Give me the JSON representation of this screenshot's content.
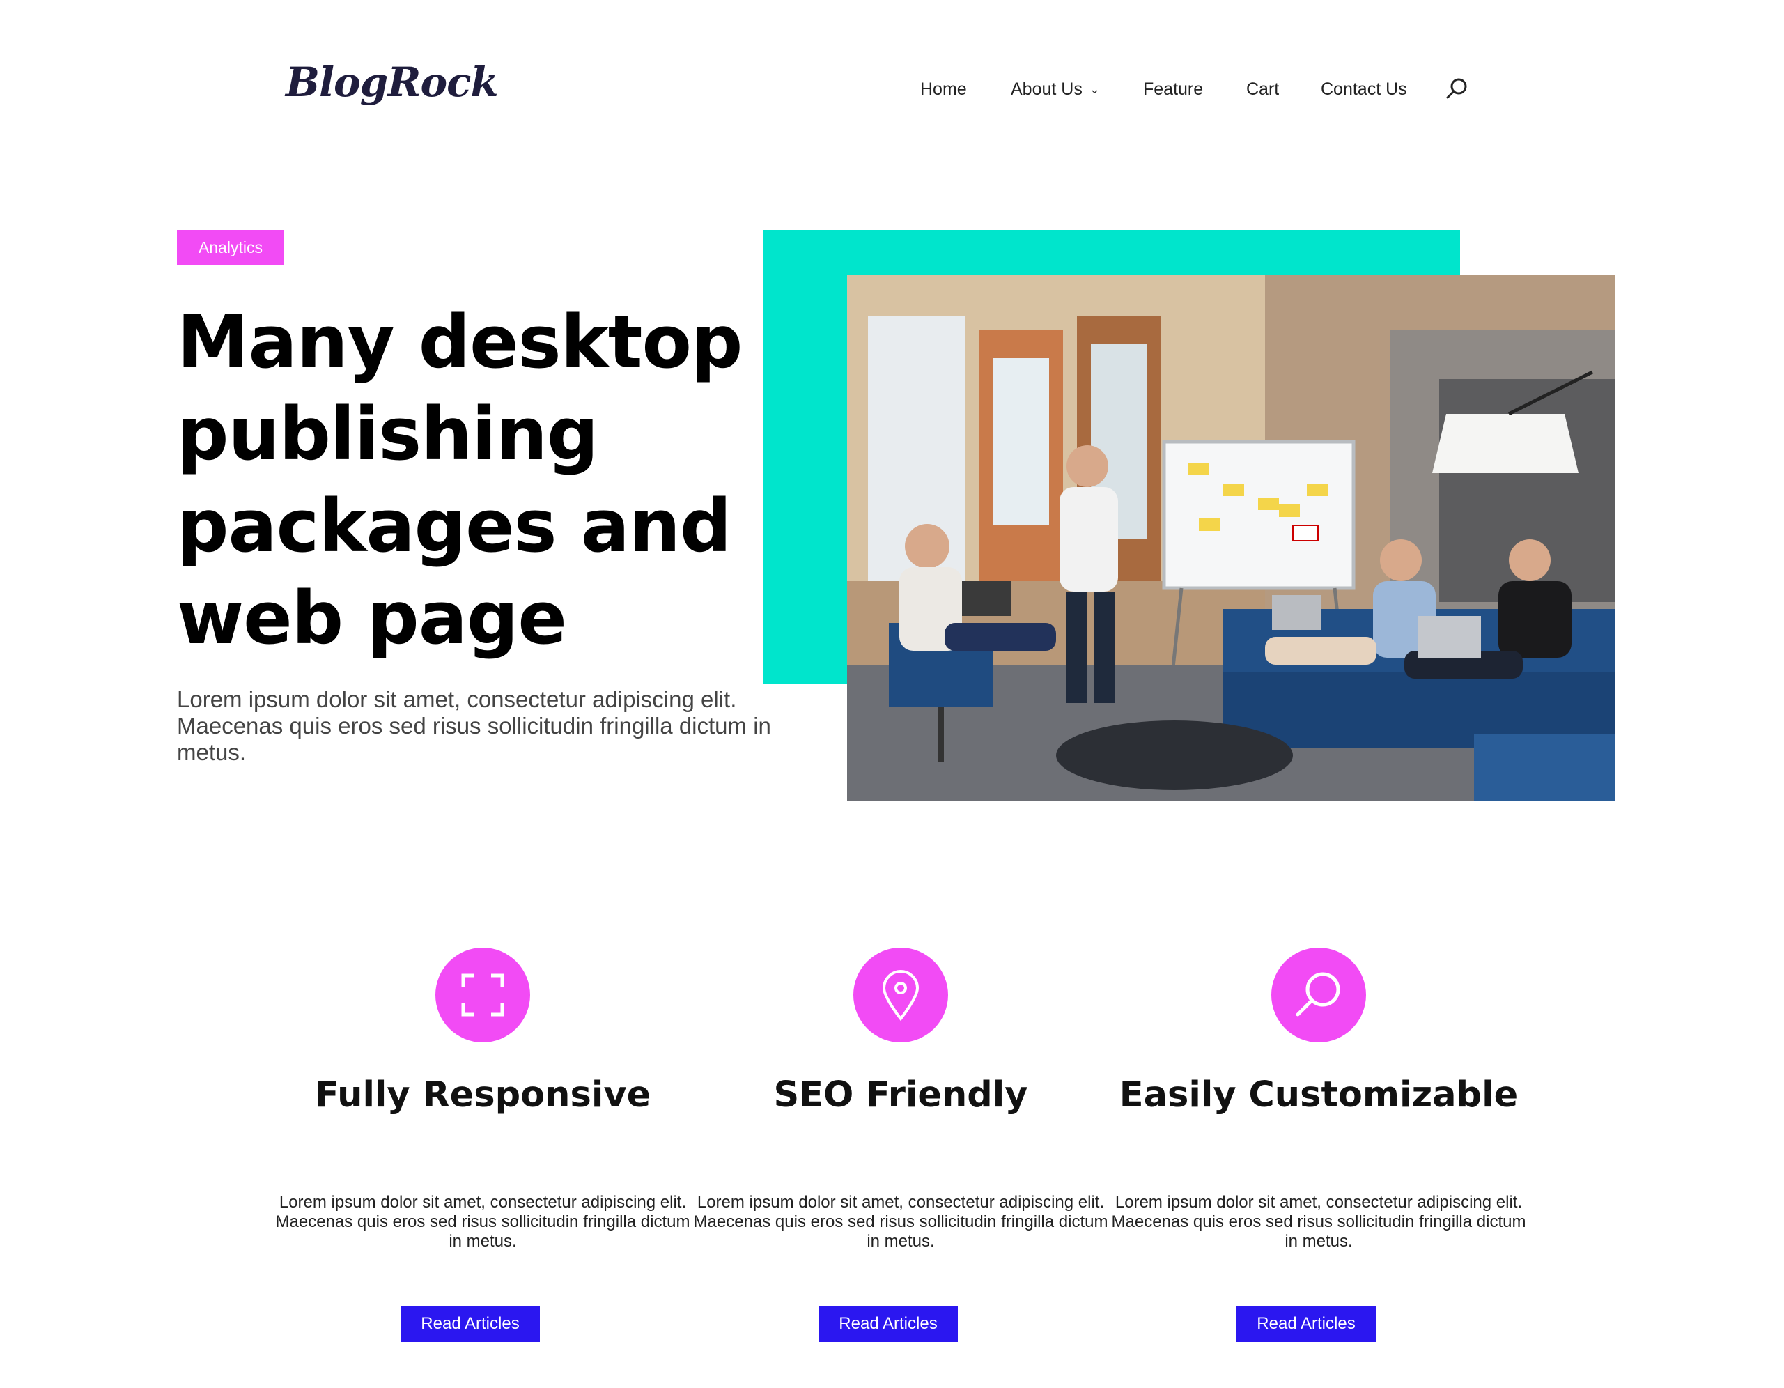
{
  "header": {
    "logo": "BlogRock",
    "nav": [
      {
        "label": "Home",
        "has_dropdown": false
      },
      {
        "label": "About Us",
        "has_dropdown": true
      },
      {
        "label": "Feature",
        "has_dropdown": false
      },
      {
        "label": "Cart",
        "has_dropdown": false
      },
      {
        "label": "Contact Us",
        "has_dropdown": false
      }
    ],
    "search_icon": "search-icon"
  },
  "hero": {
    "badge": "Analytics",
    "title": "Many desktop publishing packages and web page",
    "text": "Lorem ipsum dolor sit amet, consectetur adipiscing elit. Maecenas quis eros sed risus sollicitudin fringilla dictum in metus.",
    "image": "photo of a team meeting in an office with a whiteboard and sofa"
  },
  "features": [
    {
      "icon": "fullscreen-icon",
      "title": "Fully Responsive",
      "text": "Lorem ipsum dolor sit amet, consectetur adipiscing elit. Maecenas quis eros sed risus sollicitudin fringilla dictum in metus.",
      "button": "Read Articles"
    },
    {
      "icon": "map-pin-icon",
      "title": "SEO Friendly",
      "text": "Lorem ipsum dolor sit amet, consectetur adipiscing elit. Maecenas quis eros sed risus sollicitudin fringilla dictum in metus.",
      "button": "Read Articles"
    },
    {
      "icon": "search-icon",
      "title": "Easily Customizable",
      "text": "Lorem ipsum dolor sit amet, consectetur adipiscing elit. Maecenas quis eros sed risus sollicitudin fringilla dictum in metus.",
      "button": "Read Articles"
    }
  ],
  "colors": {
    "accent_pink": "#f24bf5",
    "accent_teal": "#00e5cc",
    "button_blue": "#2b17f0",
    "logo": "#1f1d3d"
  }
}
